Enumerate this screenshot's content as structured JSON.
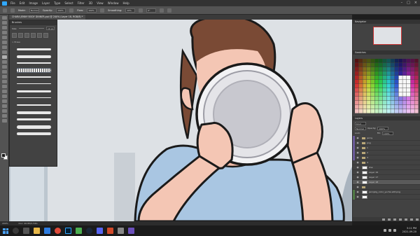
{
  "menubar": {
    "items": [
      "File",
      "Edit",
      "Image",
      "Layer",
      "Type",
      "Select",
      "Filter",
      "3D",
      "View",
      "Window",
      "Help"
    ]
  },
  "options": {
    "mode_label": "Mode:",
    "mode_value": "Normal",
    "opacity_label": "Opacity:",
    "opacity_value": "100%",
    "flow_label": "Flow:",
    "flow_value": "100%",
    "smoothing_label": "Smoothing:",
    "smoothing_value": "10%",
    "angle_value": "0°"
  },
  "document": {
    "tab_title": "CHARA JENNY BODY DINNER.psd @ 200% (Layer 18, RGB/8) *"
  },
  "brushes": {
    "title": "Brushes",
    "size_label": "Size:",
    "size_value": "10 px",
    "group_label": "> Erase"
  },
  "navigator": {
    "title": "Navigator"
  },
  "swatches": {
    "title": "Swatches"
  },
  "layers": {
    "title": "Layers",
    "kind_value": "Kind",
    "blend_value": "Normal",
    "opacity_label": "Opacity:",
    "opacity_value": "100%",
    "lock_label": "Lock:",
    "fill_label": "Fill:",
    "fill_value": "100%",
    "rows": [
      {
        "name": "jenny",
        "type": "folder",
        "tag": "#6a5a9a"
      },
      {
        "name": "png",
        "type": "folder",
        "tag": "#6a5a9a"
      },
      {
        "name": "1",
        "type": "folder",
        "tag": "#6a5a9a"
      },
      {
        "name": "2",
        "type": "folder",
        "tag": "#6a5a9a"
      },
      {
        "name": "3",
        "type": "folder",
        "tag": "#6a5a9a"
      },
      {
        "name": "4",
        "type": "folder",
        "tag": ""
      },
      {
        "name": "line",
        "type": "layer",
        "tag": ""
      },
      {
        "name": "Layer 19",
        "type": "layer",
        "tag": ""
      },
      {
        "name": "Layer 17",
        "type": "layer",
        "tag": ""
      },
      {
        "name": "Layer 18",
        "type": "layer",
        "tag": "",
        "selected": true
      },
      {
        "name": "",
        "type": "folder",
        "tag": ""
      },
      {
        "name": "jennybg_color_yucha edit.png",
        "type": "layer",
        "tag": "#4f7a45"
      },
      {
        "name": "",
        "type": "layer",
        "tag": "#4f7a45"
      }
    ]
  },
  "status": {
    "zoom": "200%",
    "doc_info": "Doc: 46.8M/1.54G"
  },
  "taskbar": {
    "time": "3:11 PM",
    "date": "2021-09-20"
  },
  "colors": {
    "accent": "#31a8ff",
    "canvas_bg": "#dde1e5",
    "hair": "#7a4a35",
    "skin": "#f4c6b4",
    "shirt": "#a9c6e2"
  }
}
